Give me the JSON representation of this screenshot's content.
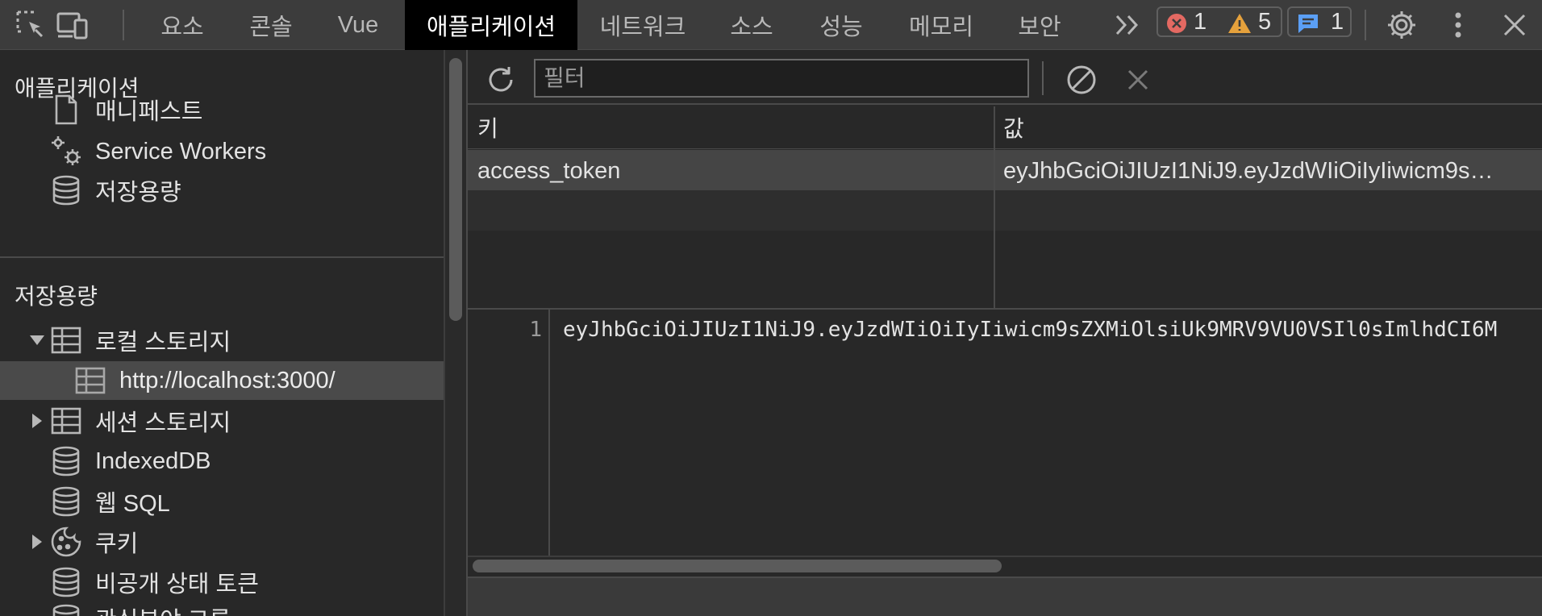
{
  "toolbar": {
    "tabs": [
      "요소",
      "콘솔",
      "Vue",
      "애플리케이션",
      "네트워크",
      "소스",
      "성능",
      "메모리",
      "보안"
    ],
    "active_tab": "애플리케이션",
    "error_count": "1",
    "warning_count": "5",
    "message_count": "1",
    "icons": [
      "inspect-icon",
      "device-toggle-icon",
      "more-tabs-icon",
      "settings-icon",
      "kebab-menu-icon",
      "close-icon"
    ]
  },
  "sidebar": {
    "application_title": "애플리케이션",
    "application_items": [
      {
        "label": "매니페스트",
        "icon": "document-icon"
      },
      {
        "label": "Service Workers",
        "icon": "gears-icon"
      },
      {
        "label": "저장용량",
        "icon": "database-icon"
      }
    ],
    "storage_title": "저장용량",
    "storage_items": [
      {
        "label": "로컬 스토리지",
        "icon": "table-icon",
        "expanded": true
      },
      {
        "label": "http://localhost:3000/",
        "icon": "table-icon",
        "selected": true
      },
      {
        "label": "세션 스토리지",
        "icon": "table-icon",
        "expanded": false
      },
      {
        "label": "IndexedDB",
        "icon": "database-icon"
      },
      {
        "label": "웹 SQL",
        "icon": "database-icon"
      },
      {
        "label": "쿠키",
        "icon": "cookie-icon",
        "expanded": false
      },
      {
        "label": "비공개 상태 토큰",
        "icon": "database-icon"
      },
      {
        "label": "관심분야 그룹",
        "icon": "database-icon"
      }
    ]
  },
  "filter": {
    "placeholder": "필터"
  },
  "table": {
    "columns": [
      "키",
      "값"
    ],
    "rows": [
      {
        "key": "access_token",
        "value": "eyJhbGciOiJIUzI1NiJ9.eyJzdWIiOiIyIiwicm9s…"
      }
    ]
  },
  "preview": {
    "line_number": "1",
    "content": "eyJhbGciOiJIUzI1NiJ9.eyJzdWIiOiIyIiwicm9sZXMiOlsiUk9MRV9VU0VSIl0sImlhdCI6M"
  },
  "colors": {
    "background": "#282828",
    "toolbar": "#3c3c3c",
    "active_tab": "#000000",
    "error": "#e46962",
    "warning": "#e5a13c",
    "message": "#5b9ff5"
  }
}
